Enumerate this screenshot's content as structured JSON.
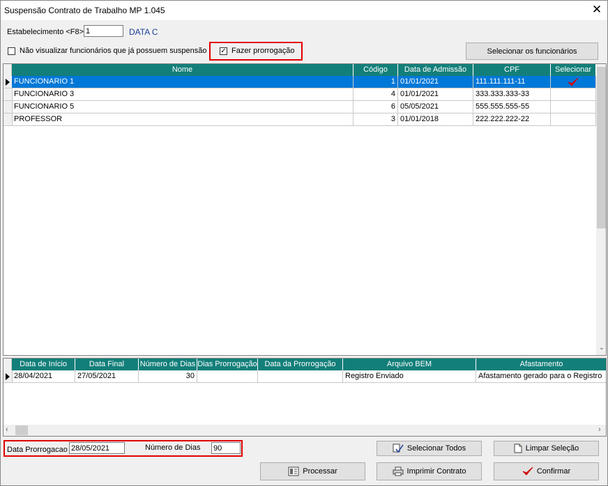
{
  "window": {
    "title": "Suspensão Contrato de Trabalho MP 1.045"
  },
  "header": {
    "estab_label": "Estabelecimento <F8>",
    "estab_value": "1",
    "estab_name": "DATA C",
    "hide_label": "Não visualizar funcionários que já possuem suspensão",
    "hide_checked": false,
    "prorrog_label": "Fazer prorrogação",
    "prorrog_checked": true,
    "select_employees_button": "Selecionar os funcionários"
  },
  "employees": {
    "columns": [
      "Nome",
      "Código",
      "Data de Admissão",
      "CPF",
      "Selecionar"
    ],
    "rows": [
      {
        "nome": "FUNCIONARIO 1",
        "codigo": "1",
        "admissao": "01/01/2021",
        "cpf": "111.111.111-11",
        "selected": true,
        "current": true
      },
      {
        "nome": "FUNCIONARIO 3",
        "codigo": "4",
        "admissao": "01/01/2021",
        "cpf": "333.333.333-33",
        "selected": false,
        "current": false
      },
      {
        "nome": "FUNCIONARIO 5",
        "codigo": "6",
        "admissao": "05/05/2021",
        "cpf": "555.555.555-55",
        "selected": false,
        "current": false
      },
      {
        "nome": "PROFESSOR",
        "codigo": "3",
        "admissao": "01/01/2018",
        "cpf": "222.222.222-22",
        "selected": false,
        "current": false
      }
    ]
  },
  "suspensions": {
    "columns": [
      "Data de Início",
      "Data Final",
      "Número de Dias",
      "Dias Prorrogação",
      "Data da Prorrogação",
      "Arquivo BEM",
      "Afastamento"
    ],
    "rows": [
      {
        "inicio": "28/04/2021",
        "final": "27/05/2021",
        "dias": "30",
        "dias_prorrog": "",
        "data_prorrog": "",
        "arquivo": "Registro Enviado",
        "afastamento": "Afastamento gerado para o Registro"
      }
    ]
  },
  "footer": {
    "data_prorrog_label": "Data Prorrogacao",
    "data_prorrog_value": "28/05/2021",
    "num_dias_label": "Número de Dias",
    "num_dias_value": "90",
    "select_all_button": "Selecionar Todos",
    "clear_button": "Limpar Seleção",
    "process_button": "Processar",
    "print_button": "Imprimir Contrato",
    "confirm_button": "Confirmar"
  },
  "colors": {
    "header_bg": "#137f7a",
    "selection": "#0078d7",
    "highlight": "#e00000",
    "check": "#d00000"
  }
}
